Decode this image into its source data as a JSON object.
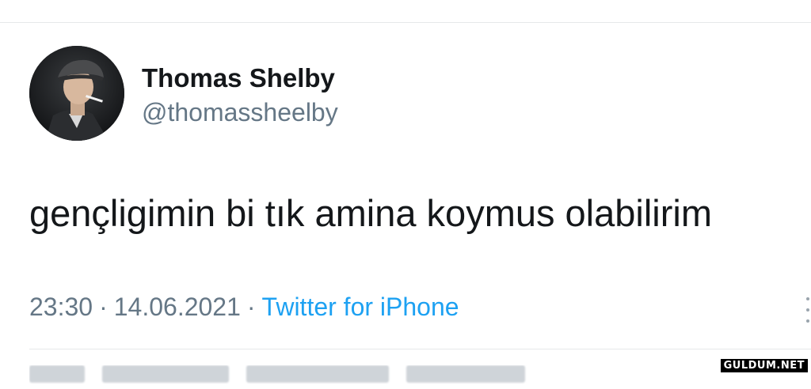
{
  "tweet": {
    "author": {
      "display_name": "Thomas Shelby",
      "handle": "@thomassheelby"
    },
    "text": "gençligimin bi tık amina koymus olabilirim",
    "time": "23:30",
    "date": "14.06.2021",
    "separator": "·",
    "source": "Twitter for iPhone"
  },
  "watermark": "GULDUM.NET",
  "colors": {
    "text_primary": "#14171a",
    "text_secondary": "#657786",
    "link_blue": "#1da1f2",
    "divider": "#e6e8ea"
  },
  "icons": {
    "more": "more-vertical-icon"
  }
}
